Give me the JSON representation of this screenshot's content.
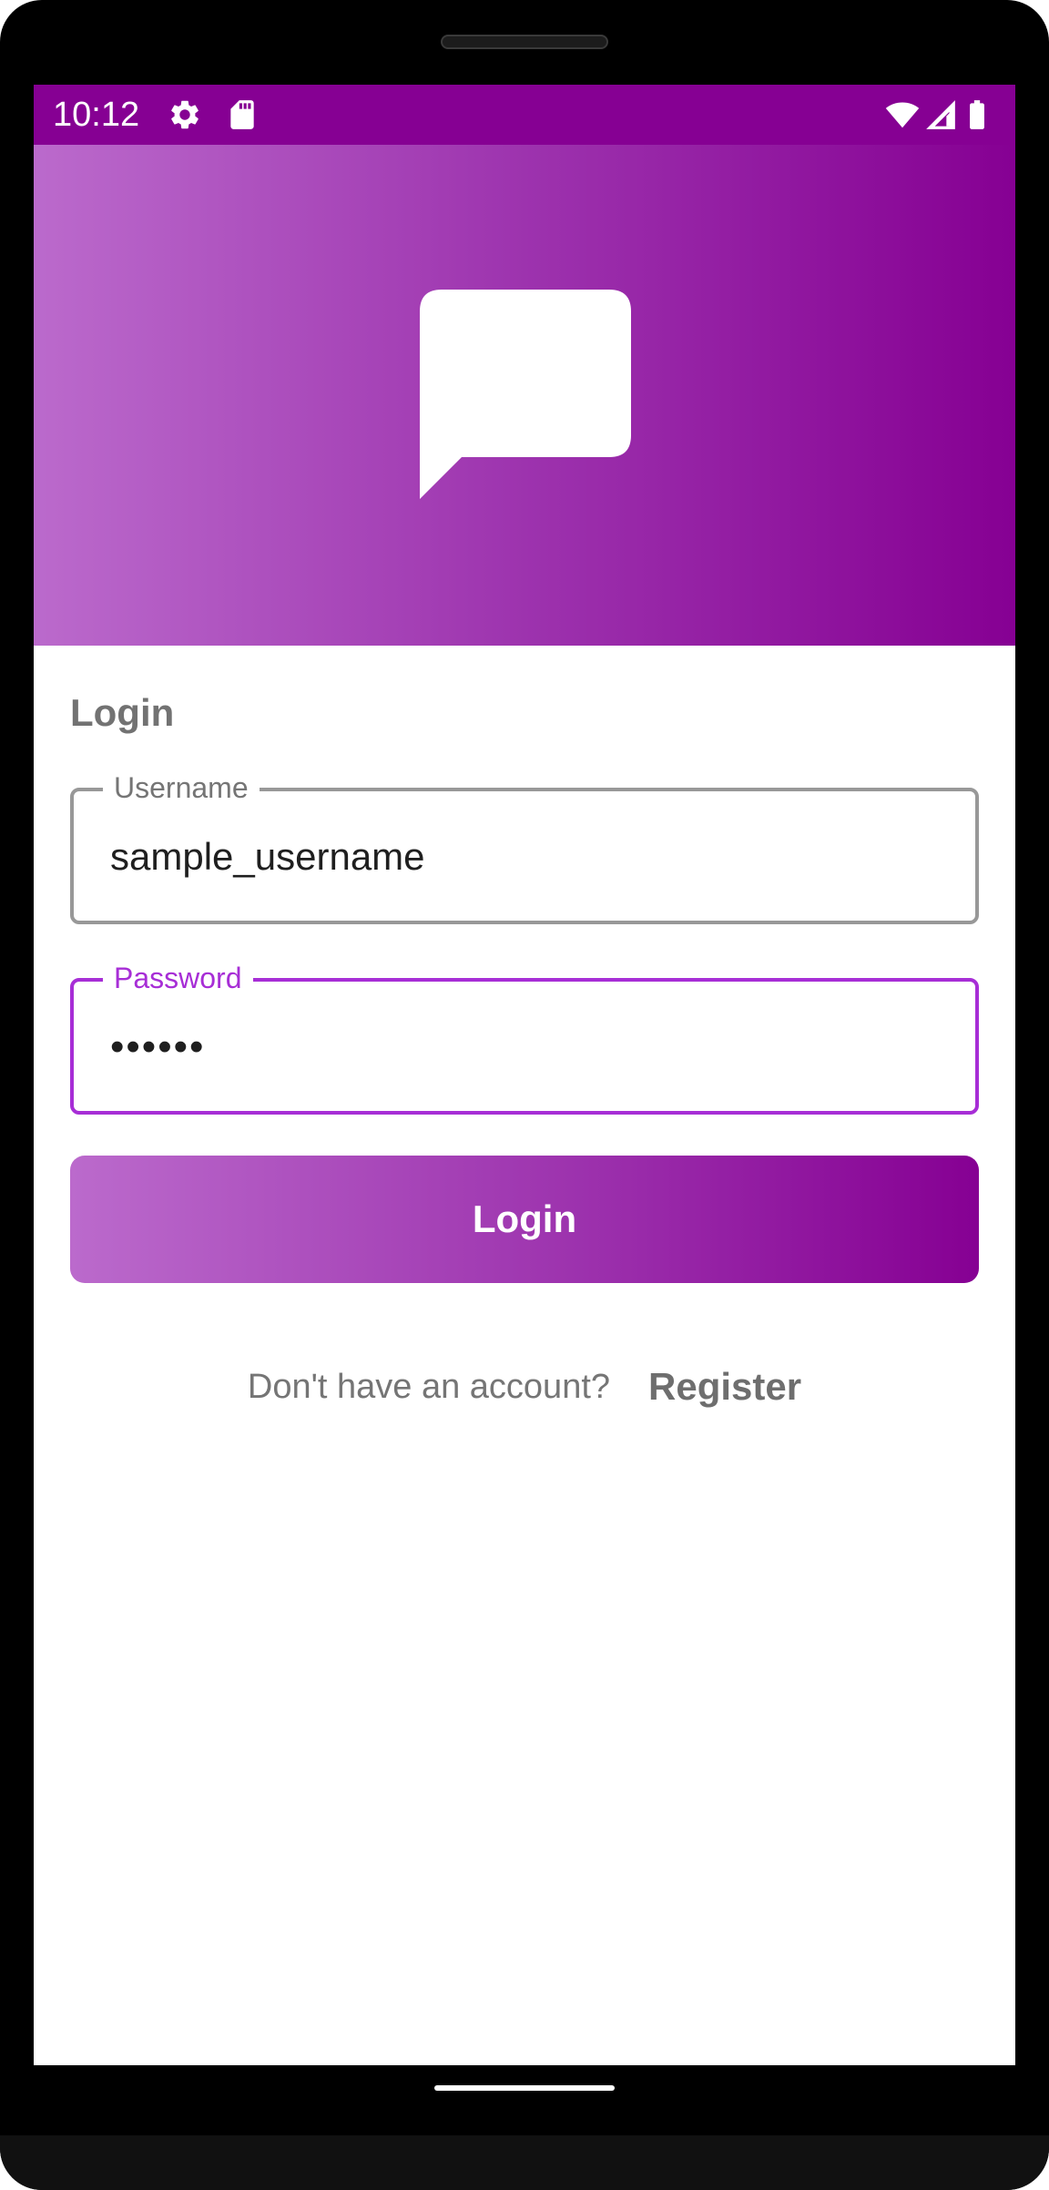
{
  "status_bar": {
    "time": "10:12",
    "icons": [
      "settings-icon",
      "sd-card-icon",
      "wifi-icon",
      "signal-icon",
      "battery-icon"
    ],
    "color": "#860093"
  },
  "header": {
    "logo_icon": "chat-bubble-icon",
    "gradient": [
      "#bb6acc",
      "#860093"
    ]
  },
  "form": {
    "title": "Login",
    "username": {
      "label": "Username",
      "value": "sample_username"
    },
    "password": {
      "label": "Password",
      "value": "••••••"
    },
    "submit_label": "Login"
  },
  "footer": {
    "prompt": "Don't have an account?",
    "register_label": "Register"
  },
  "colors": {
    "accent": "#a72ed6",
    "primary": "#860093"
  }
}
